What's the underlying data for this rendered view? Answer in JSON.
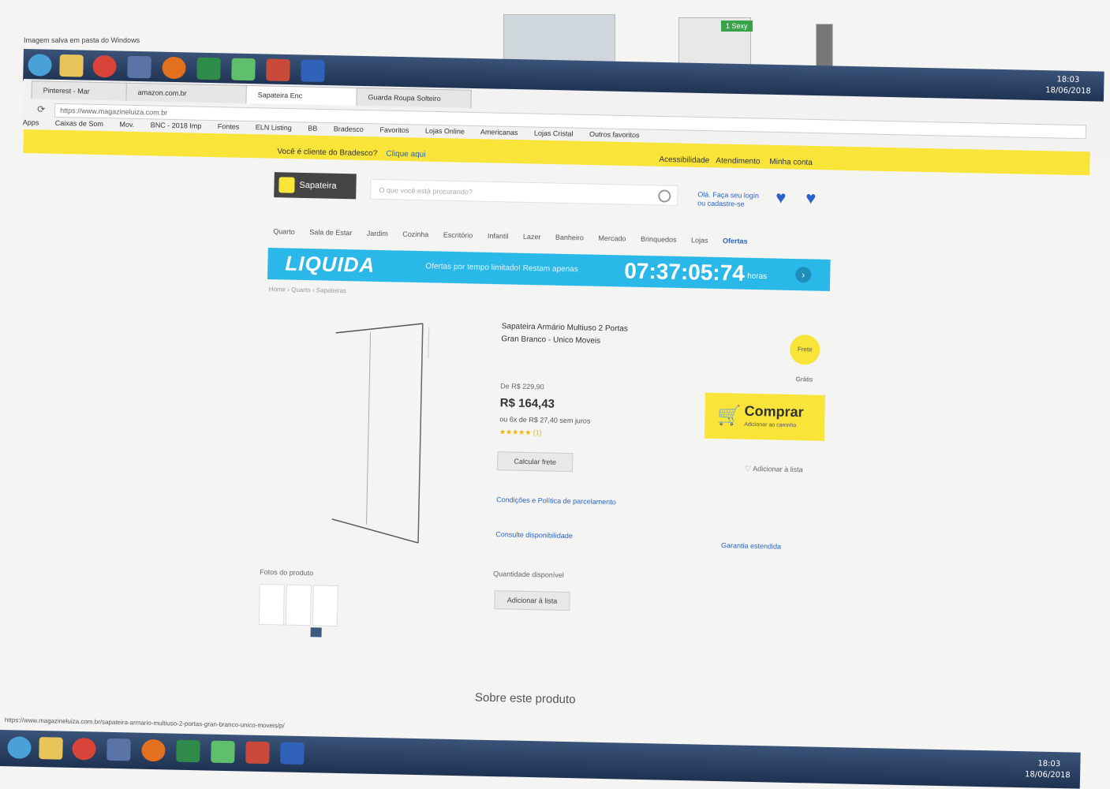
{
  "desktop": {
    "top_caption": "Imagem salva em pasta do Windows",
    "green_label": "1 Sexy"
  },
  "taskbar": {
    "tray_time": "18:03",
    "tray_date": "18/06/2018"
  },
  "browser": {
    "tabs": [
      "Pinterest - Mar",
      "amazon.com.br",
      "Sapateira Enc",
      "Guarda Roupa Solteiro"
    ],
    "address": "https://www.magazineluiza.com.br",
    "bookmarks": [
      "Apps",
      "Caixas de Som",
      "Mov.",
      "BNC - 2018 Imp",
      "Fontes",
      "ELN Listing",
      "BB",
      "Bradesco",
      "Favoritos",
      "Lojas Online",
      "Americanas",
      "Lojas Cristal",
      "Outros favoritos"
    ]
  },
  "notice_bar": {
    "text": "Você é cliente do Bradesco?",
    "link": "Clique aqui",
    "right_links": [
      "Acessibilidade",
      "Atendimento",
      "Minha conta"
    ]
  },
  "store": {
    "logo": "Sapateira",
    "search_placeholder": "O que você está procurando?",
    "login": "Olá. Faça seu login ou cadastre-se",
    "nav": [
      "Quarto",
      "Sala de Estar",
      "Jardim",
      "Cozinha",
      "Escritório",
      "Infantil",
      "Lazer",
      "Banheiro",
      "Mercado",
      "Brinquedos",
      "Lojas",
      "Ofertas"
    ],
    "banner": {
      "liquida": "LIQUIDA",
      "text": "Ofertas por tempo limitado! Restam apenas",
      "timer": "07:37:05:74",
      "unit": "horas"
    },
    "breadcrumb": "Home › Quarto › Sapateiras"
  },
  "product": {
    "title_line1": "Sapateira Armário Multiuso 2 Portas",
    "title_line2": "Gran Branco - Unico Moveis",
    "badge": "Frete Grátis",
    "price_old": "De R$ 229,90",
    "price": "R$ 164,43",
    "price_note": "ou 6x de R$ 27,40 sem juros",
    "rating": "★★★★★ (1)",
    "calc_button": "Calcular frete",
    "buy_label": "Comprar",
    "buy_sub": "Adicionar ao carrinho",
    "wishlist": "Adicionar à lista",
    "link_condicoes": "Condições e Política de parcelamento",
    "link_consulte": "Consulte disponibilidade",
    "link_garantia": "Garantia estendida",
    "photos_label": "Fotos do produto",
    "qty_label": "Quantidade disponível",
    "add_list": "Adicionar à lista",
    "about": "Sobre este produto"
  },
  "status_url": "https://www.magazineluiza.com.br/sapateira-armario-multiuso-2-portas-gran-branco-unico-moveis/p/"
}
